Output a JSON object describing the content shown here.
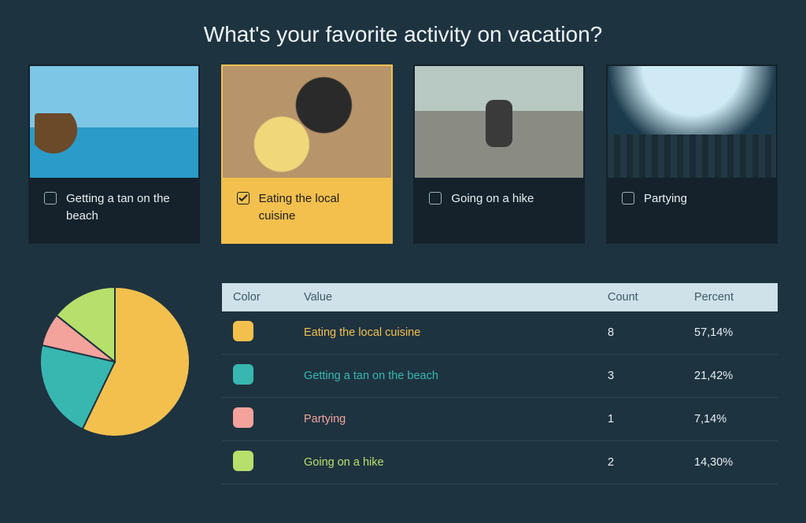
{
  "question": "What's your favorite activity on vacation?",
  "options": [
    {
      "label": "Getting a tan on the beach",
      "selected": false,
      "imgClass": "img-beach"
    },
    {
      "label": "Eating the local cuisine",
      "selected": true,
      "imgClass": "img-food"
    },
    {
      "label": "Going on a hike",
      "selected": false,
      "imgClass": "img-hike"
    },
    {
      "label": "Partying",
      "selected": false,
      "imgClass": "img-party"
    }
  ],
  "resultsTable": {
    "headers": {
      "color": "Color",
      "value": "Value",
      "count": "Count",
      "percent": "Percent"
    },
    "rows": [
      {
        "color": "#f3c04e",
        "value": "Eating the local cuisine",
        "count": "8",
        "percent": "57,14%"
      },
      {
        "color": "#37b7b0",
        "value": "Getting a tan on the beach",
        "count": "3",
        "percent": "21,42%"
      },
      {
        "color": "#f3a39b",
        "value": "Partying",
        "count": "1",
        "percent": "7,14%"
      },
      {
        "color": "#b6e06b",
        "value": "Going on a hike",
        "count": "2",
        "percent": "14,30%"
      }
    ]
  },
  "chart_data": {
    "type": "pie",
    "title": "What's your favorite activity on vacation?",
    "series": [
      {
        "name": "Eating the local cuisine",
        "value": 8,
        "percent": 57.14,
        "color": "#f3c04e"
      },
      {
        "name": "Getting a tan on the beach",
        "value": 3,
        "percent": 21.42,
        "color": "#37b7b0"
      },
      {
        "name": "Partying",
        "value": 1,
        "percent": 7.14,
        "color": "#f3a39b"
      },
      {
        "name": "Going on a hike",
        "value": 2,
        "percent": 14.3,
        "color": "#b6e06b"
      }
    ]
  }
}
